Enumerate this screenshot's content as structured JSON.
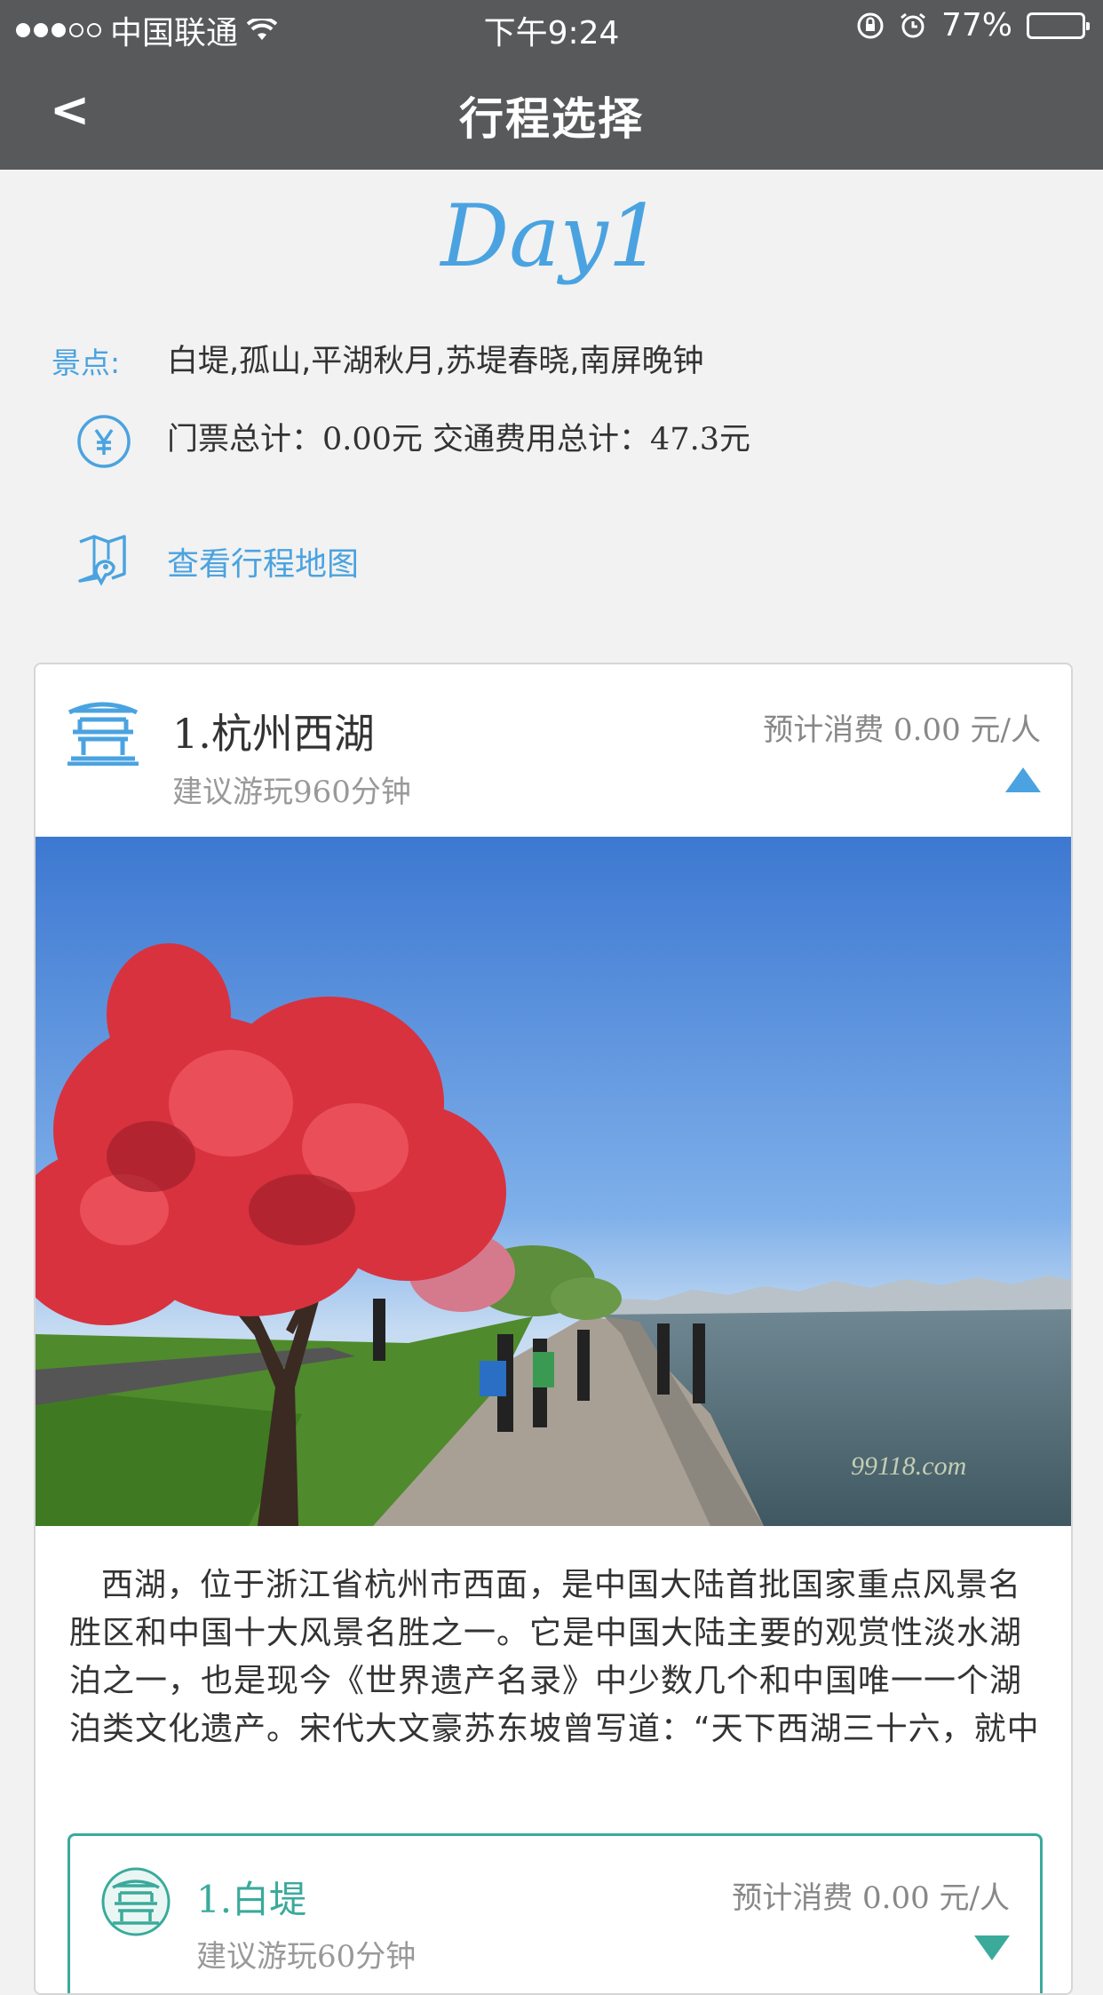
{
  "status_bar": {
    "carrier": "中国联通",
    "time": "下午9:24",
    "battery": "77%",
    "battery_level": 0.77
  },
  "nav": {
    "back_label": "<",
    "title": "行程选择"
  },
  "day": {
    "title": "Day1",
    "spots_label": "景点:",
    "spots": "白堤,孤山,平湖秋月,苏堤春晓,南屏晚钟",
    "cost_summary": "门票总计：0.00元  交通费用总计：47.3元",
    "map_link": "查看行程地图"
  },
  "card": {
    "name": "1.杭州西湖",
    "duration": "建议游玩960分钟",
    "cost": "预计消费 0.00 元/人",
    "photo_watermark": "99118.com",
    "description": "西湖，位于浙江省杭州市西面，是中国大陆首批国家重点风景名胜区和中国十大风景名胜之一。它是中国大陆主要的观赏性淡水湖泊之一，也是现今《世界遗产名录》中少数几个和中国唯一一个湖泊类文化遗产。宋代大文豪苏东坡曾写道：“天下西湖三十六，就中最好是杭"
  },
  "sub_card": {
    "name": "1.白堤",
    "duration": "建议游玩60分钟",
    "cost": "预计消费 0.00 元/人"
  },
  "colors": {
    "accent_blue": "#4aa3e0",
    "accent_teal": "#3aaa9b",
    "header_bg": "#58595b"
  }
}
